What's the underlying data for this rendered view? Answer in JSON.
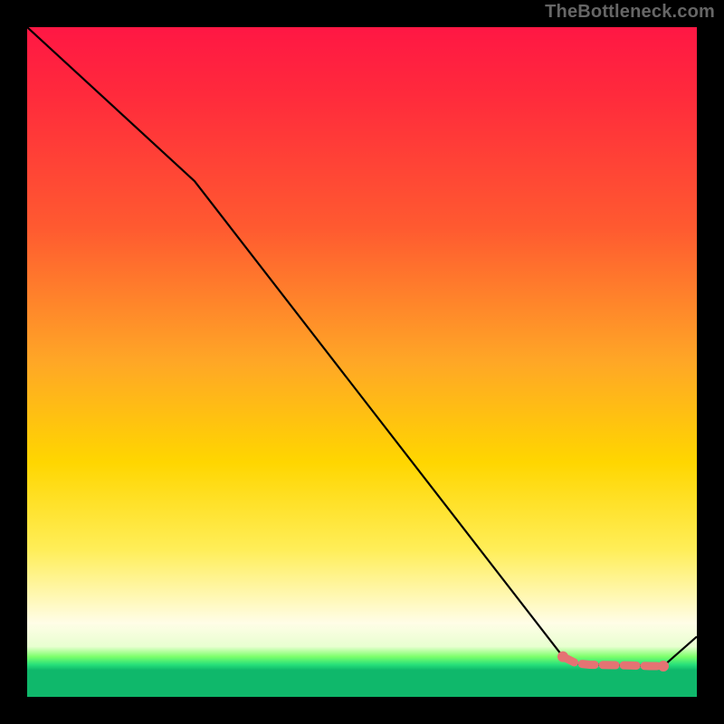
{
  "watermark": "TheBottleneck.com",
  "chart_data": {
    "type": "line",
    "title": "",
    "xlabel": "",
    "ylabel": "",
    "xlim": [
      0,
      100
    ],
    "ylim": [
      0,
      100
    ],
    "grid": false,
    "legend": false,
    "series": [
      {
        "name": "main-curve",
        "color": "#000000",
        "x": [
          0,
          25,
          80,
          82,
          84,
          90,
          93,
          95,
          100
        ],
        "y": [
          100,
          77,
          6,
          5,
          4.8,
          4.7,
          4.6,
          4.6,
          9
        ]
      },
      {
        "name": "highlight-segment",
        "color": "#e57373",
        "style": "dashed-with-endpoints",
        "x": [
          80,
          82,
          84,
          90,
          93,
          95
        ],
        "y": [
          6,
          5,
          4.8,
          4.7,
          4.6,
          4.6
        ]
      }
    ]
  }
}
